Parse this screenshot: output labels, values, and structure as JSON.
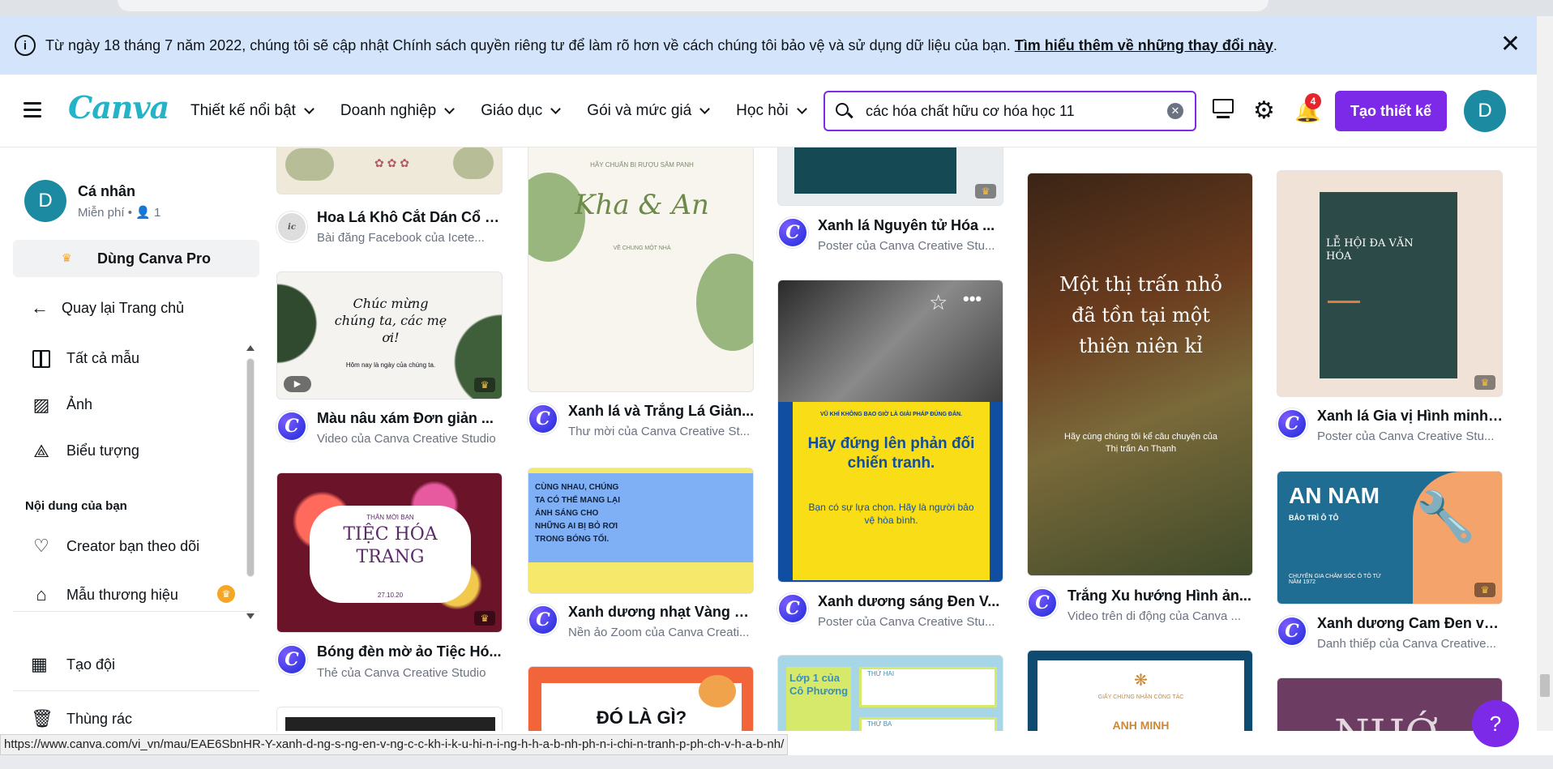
{
  "banner": {
    "message": "Từ ngày 18 tháng 7 năm 2022, chúng tôi sẽ cập nhật Chính sách quyền riêng tư để làm rõ hơn về cách chúng tôi bảo vệ và sử dụng dữ liệu của bạn. ",
    "link": "Tìm hiểu thêm về những thay đổi này",
    "after": ".",
    "close": "✕"
  },
  "header": {
    "logo": "Canva",
    "nav": [
      "Thiết kế nổi bật",
      "Doanh nghiệp",
      "Giáo dục",
      "Gói và mức giá",
      "Học hỏi"
    ],
    "search_value": "các hóa chất hữu cơ hóa học 11",
    "notif_count": "4",
    "create_label": "Tạo thiết kế",
    "avatar": "D"
  },
  "sidebar": {
    "avatar": "D",
    "name": "Cá nhân",
    "plan": "Miễn phí • 👤 1",
    "pro": "Dùng Canva Pro",
    "back": "Quay lại Trang chủ",
    "items": [
      {
        "label": "Tất cả mẫu",
        "icon": "template-icon"
      },
      {
        "label": "Ảnh",
        "icon": "photo-icon"
      },
      {
        "label": "Biểu tượng",
        "icon": "shapes-icon"
      }
    ],
    "section_title": "Nội dung của bạn",
    "items2": [
      {
        "label": "Creator bạn theo dõi",
        "icon": "heart-icon"
      },
      {
        "label": "Mẫu thương hiệu",
        "icon": "brand-icon"
      }
    ],
    "team": "Tạo đội",
    "trash": "Thùng rác"
  },
  "cards": [
    {
      "title": "Hoa Lá Khô Cắt Dán Cổ Đ...",
      "sub": "Bài đăng Facebook của   Icete..."
    },
    {
      "title": "Màu nâu xám Đơn giản ...",
      "sub": "Video của Canva Creative Studio"
    },
    {
      "title": "Bóng đèn mờ ảo Tiệc Hó...",
      "sub": "Thẻ của Canva Creative Studio"
    },
    {
      "title": "Xanh lá và Trắng Lá Giản...",
      "sub": "Thư mời của Canva Creative St..."
    },
    {
      "title": "Xanh dương nhạt Vàng n...",
      "sub": "Nền ảo Zoom của Canva Creati..."
    },
    {
      "title": "Xanh lá Nguyên tử Hóa ...",
      "sub": "Poster của Canva Creative Stu..."
    },
    {
      "title": "Xanh dương sáng Đen V...",
      "sub": "Poster của Canva Creative Stu..."
    },
    {
      "title": "Trắng Xu hướng Hình ản...",
      "sub": "Video trên di động của Canva ..."
    },
    {
      "title": "Xanh lá Gia vị Hình minh ...",
      "sub": "Poster của Canva Creative Stu..."
    },
    {
      "title": "Xanh dương Cam Đen và...",
      "sub": "Danh thiếp của Canva Creative..."
    }
  ],
  "thumb_text": {
    "chuc_mung": "Chúc mừng chúng ta, các mẹ ơi!",
    "chuc_mung_sub": "Hôm nay là ngày của chúng ta.",
    "tiec_top": "THÂN MỜI BẠN",
    "tiec": "TIỆC HÓA TRANG",
    "tiec_date": "27.10.20",
    "wedding_top": "HÃY CHUẨN BỊ RƯỢU SÂM PANH",
    "wedding": "Kha & An",
    "wedding_sub": "VỀ CHUNG MỘT NHÀ",
    "zoom": "CÙNG NHAU, CHÚNG TA CÓ THỂ MANG LẠI ÁNH SÁNG CHO NHỮNG AI BỊ BỎ RƠI TRONG BÓNG TỐI.",
    "war_top": "VŨ KHÍ KHÔNG BAO GIỜ LÀ GIẢI PHÁP ĐÚNG ĐẮN.",
    "war": "Hãy đứng lên phản đối chiến tranh.",
    "war_sub": "Bạn có sự lựa chọn. Hãy là người bảo vệ hòa bình.",
    "town": "Một thị trấn nhỏ đã tồn tại một thiên niên kỉ",
    "town_sub": "Hãy cùng chúng tôi kể câu chuyện của Thị trấn An Thạnh",
    "lehoi": "LỄ HỘI ĐA VĂN HÓA",
    "annam": "AN NAM",
    "annam_sub": "BẢO TRÌ Ô TÔ",
    "annam_small": "CHUYÊN GIA CHĂM SÓC Ô TÔ TỪ NĂM 1972",
    "dola": "ĐÓ LÀ GÌ?",
    "lop1": "Lớp 1 của Cô Phương",
    "lop_thu2": "THỨ HAI",
    "lop_thu3": "THỨ BA",
    "cert_top": "GIẤY CHỨNG NHẬN CÔNG TÁC",
    "cert_name": "ANH MINH",
    "nho": "NHỚ"
  },
  "status_url": "https://www.canva.com/vi_vn/mau/EAE6SbnHR-Y-xanh-d-ng-s-ng-en-v-ng-c-c-kh-i-k-u-hi-n-i-ng-h-h-a-b-nh-ph-n-i-chi-n-tranh-p-ph-ch-v-h-a-b-nh/",
  "help": "?"
}
